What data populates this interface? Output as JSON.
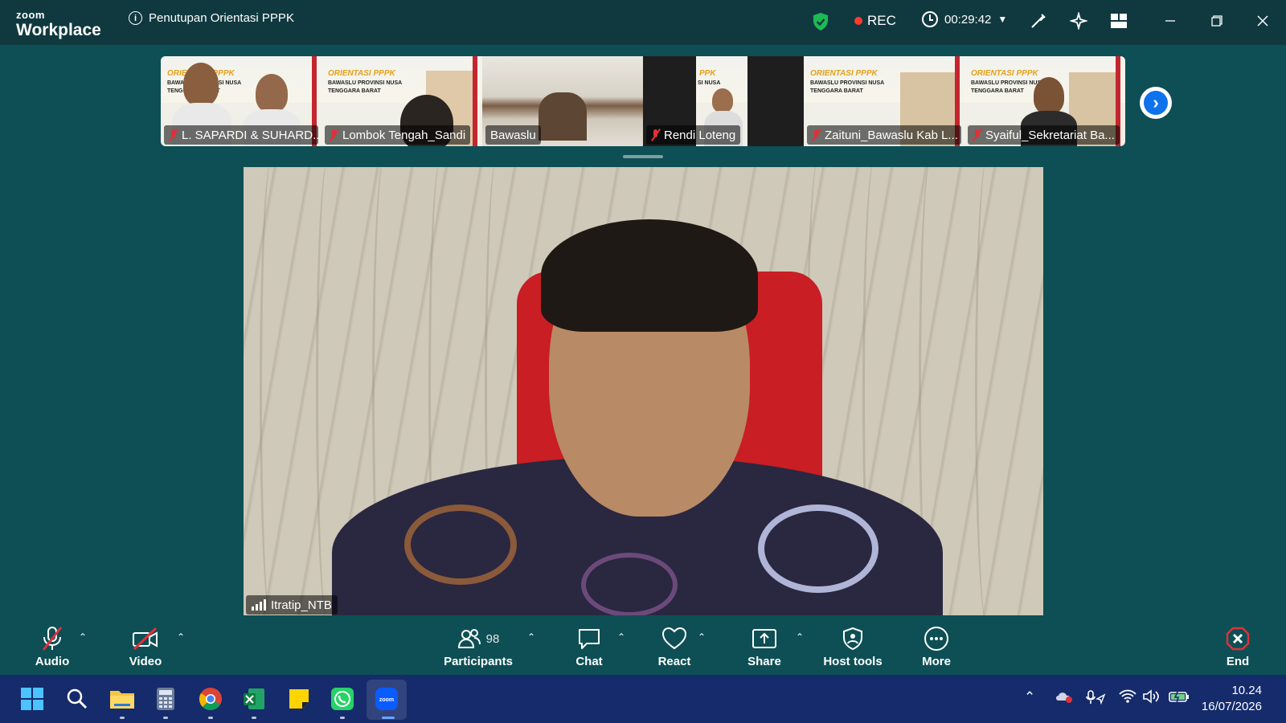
{
  "app": {
    "logo_top": "zoom",
    "logo_bottom": "Workplace"
  },
  "meeting": {
    "title": "Penutupan Orientasi PPPK",
    "rec_label": "REC",
    "elapsed": "00:29:42"
  },
  "thumbnails": [
    {
      "name": "L. SAPARDI & SUHARD...",
      "muted": true,
      "banner_title": "ORIENTASI PPPK",
      "banner_line1": "BAWASLU PROVINSI NUSA",
      "banner_line2": "TENGGARA BARAT"
    },
    {
      "name": "Lombok Tengah_Sandi",
      "muted": true,
      "banner_title": "ORIENTASI PPPK",
      "banner_line1": "BAWASLU PROVINSI NUSA",
      "banner_line2": "TENGGARA BARAT"
    },
    {
      "name": "Bawaslu",
      "muted": false
    },
    {
      "name": "Rendi Loteng",
      "muted": true,
      "banner_title": "PPK",
      "banner_line1": "SI NUSA",
      "banner_line2": ""
    },
    {
      "name": "Zaituni_Bawaslu Kab L...",
      "muted": true,
      "banner_title": "ORIENTASI PPPK",
      "banner_line1": "BAWASLU PROVINSI NUSA",
      "banner_line2": "TENGGARA BARAT"
    },
    {
      "name": "Syaiful_Sekretariat Ba...",
      "muted": true,
      "banner_title": "ORIENTASI PPPK",
      "banner_line1": "BAWASLU PROVINSI NUSA",
      "banner_line2": "TENGGARA BARAT"
    }
  ],
  "active_speaker": {
    "name": "Itratip_NTB"
  },
  "toolbar": {
    "audio": "Audio",
    "video": "Video",
    "participants": "Participants",
    "participants_count": "98",
    "chat": "Chat",
    "react": "React",
    "share": "Share",
    "host_tools": "Host tools",
    "more": "More",
    "end": "End"
  },
  "taskbar": {
    "apps": [
      "start-icon",
      "search-icon",
      "file-explorer-icon",
      "calculator-icon",
      "chrome-icon",
      "excel-icon",
      "sticky-notes-icon",
      "whatsapp-icon",
      "zoom-icon"
    ],
    "time": "10.24",
    "date": "16/07/2026"
  },
  "colors": {
    "titlebar": "#10393f",
    "background": "#0d4f55",
    "taskbar": "#152b6b",
    "rec": "#ff3b30",
    "end": "#e0303a",
    "accent": "#0e72ed"
  }
}
